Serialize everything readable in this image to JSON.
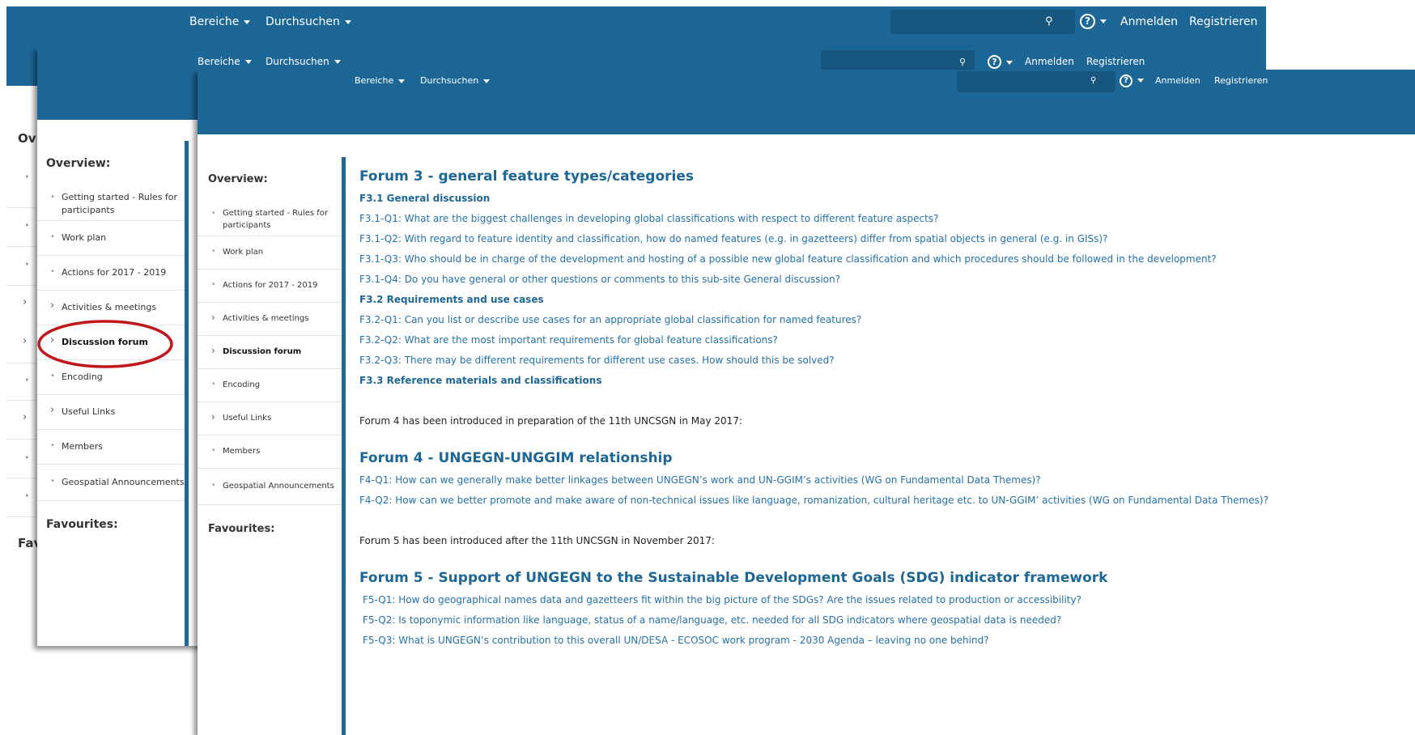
{
  "nav": {
    "bereiche": "Bereiche",
    "durchsuchen": "Durchsuchen",
    "anmelden": "Anmelden",
    "registrieren": "Registrieren",
    "help_glyph": "?",
    "search_glyph": "⚲"
  },
  "left_fragments": [
    "Ov",
    "Fav"
  ],
  "sidebar": {
    "overview_title": "Overview:",
    "favourites_title": "Favourites:",
    "items": [
      {
        "label": "Getting started - Rules for participants",
        "marker": "•"
      },
      {
        "label": "Work plan",
        "marker": "•"
      },
      {
        "label": "Actions for 2017 - 2019",
        "marker": "•"
      },
      {
        "label": "Activities & meetings",
        "marker": "›"
      },
      {
        "label": "Discussion forum",
        "marker": "›"
      },
      {
        "label": "Encoding",
        "marker": "•"
      },
      {
        "label": "Useful Links",
        "marker": "›"
      },
      {
        "label": "Members",
        "marker": "•"
      },
      {
        "label": "Geospatial Announcements",
        "marker": "•"
      }
    ]
  },
  "content": {
    "forum3_title": "Forum 3 - general feature types/categories",
    "f31_title": "F3.1 General discussion",
    "f31_q1": "F3.1-Q1: What are the biggest challenges in developing global classifications with respect to different feature aspects?",
    "f31_q2": "F3.1-Q2: With regard to feature identity and classification, how do named features (e.g. in gazetteers) differ from spatial objects in general (e.g. in GISs)?",
    "f31_q3": "F3.1-Q3: Who should be in charge of the development and hosting of a possible new global feature classification and which procedures should be followed in the development?",
    "f31_q4": "F3.1-Q4: Do you have general or other questions or comments to this sub-site General discussion?",
    "f32_title": "F3.2 Requirements and use cases",
    "f32_q1": "F3.2-Q1: Can you list or describe use cases for an appropriate global classification for named features?",
    "f32_q2": "F3.2-Q2: What are the most important requirements for global feature classifications?",
    "f32_q3": "F3.2-Q3: There may be different requirements for different use cases. How should this be solved?",
    "f33_title": "F3.3 Reference materials and classifications",
    "forum4_intro": "Forum 4 has been introduced in preparation of the 11th UNCSGN in May 2017:",
    "forum4_title": "Forum 4 - UNGEGN-UNGGIM relationship",
    "f4_q1": "F4-Q1: How can we generally make better linkages between UNGEGN’s work and UN-GGIM’s activities (WG on Fundamental Data Themes)?",
    "f4_q2": "F4-Q2: How can we better promote and make aware of non-technical issues like language, romanization, cultural heritage etc. to UN-GGIM’ activities (WG on Fundamental Data Themes)?",
    "forum5_intro": "Forum 5 has been introduced after the 11th UNCSGN in November 2017:",
    "forum5_title": "Forum 5 - Support of UNGEGN to the Sustainable Development Goals (SDG) indicator framework",
    "f5_q1": "F5-Q1:  How do geographical names data and gazetteers fit within the big picture of the SDGs? Are the issues related to production or accessibility?",
    "f5_q2": "F5-Q2: Is toponymic information like language, status of a name/language, etc. needed for all SDG indicators where geospatial data is needed?",
    "f5_q3": "F5-Q3: What is UNGEGN’s contribution to this overall UN/DESA - ECOSOC work program - 2030 Agenda – leaving no one behind?"
  },
  "colors": {
    "header_blue": "#1d6796",
    "link_blue": "#2471a8",
    "highlight_red": "#c0161c"
  }
}
